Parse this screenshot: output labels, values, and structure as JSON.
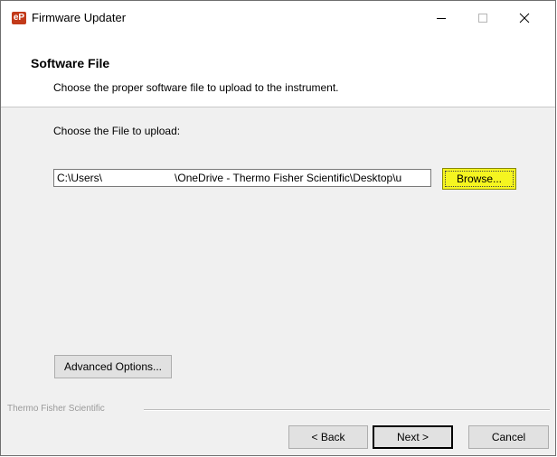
{
  "window": {
    "title": "Firmware Updater",
    "icon_text": "eP",
    "icon_name": "app-logo-icon"
  },
  "title_controls": {
    "minimize_icon": "minimize-icon",
    "maximize_icon": "maximize-icon",
    "close_icon": "close-icon"
  },
  "header": {
    "title": "Software File",
    "subtitle": "Choose the proper software file to upload to the instrument."
  },
  "main": {
    "choose_label": "Choose the File to upload:",
    "file_path_value": "C:\\Users\\                        \\OneDrive - Thermo Fisher Scientific\\Desktop\\u",
    "browse_label": "Browse...",
    "advanced_label": "Advanced Options..."
  },
  "footer": {
    "brand": "Thermo Fisher Scientific",
    "back_label": "< Back",
    "next_label": "Next >",
    "cancel_label": "Cancel"
  },
  "colors": {
    "browse_highlight": "#f5f520",
    "window_bg": "#f0f0f0",
    "header_bg": "#ffffff"
  }
}
